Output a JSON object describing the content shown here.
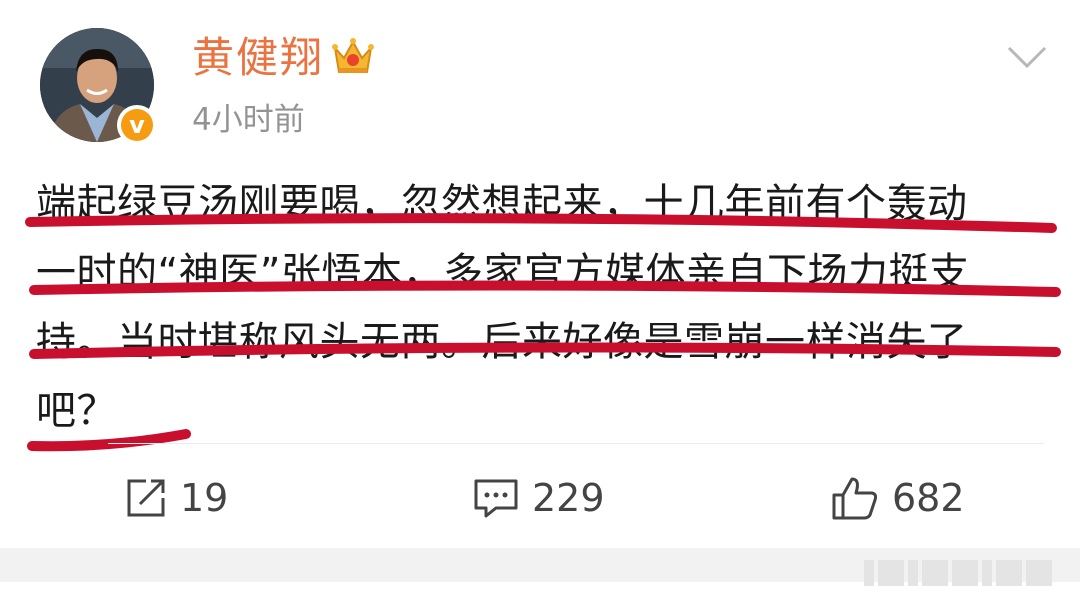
{
  "post": {
    "user": {
      "name": "黄健翔",
      "verified_badge": "v",
      "avatar_icon": "avatar-photo",
      "badge_icon": "crown-icon"
    },
    "time": "4小时前",
    "menu_icon": "chevron-down-icon",
    "text_lines": [
      "端起绿豆汤刚要喝，忽然想起来，十几年前有个轰动",
      "一时的“神医”张悟本，多家官方媒体亲自下场力挺支",
      "持。当时堪称风头无两。后来好像是雪崩一样消失了",
      "吧？"
    ],
    "actions": {
      "repost": {
        "icon": "share-icon",
        "count": "19"
      },
      "comment": {
        "icon": "comment-icon",
        "count": "229"
      },
      "like": {
        "icon": "thumbs-up-icon",
        "count": "682"
      }
    }
  },
  "colors": {
    "username": "#eb7340",
    "timestamp": "#939393",
    "underline": "#c8102e",
    "verified": "#f59c13"
  }
}
